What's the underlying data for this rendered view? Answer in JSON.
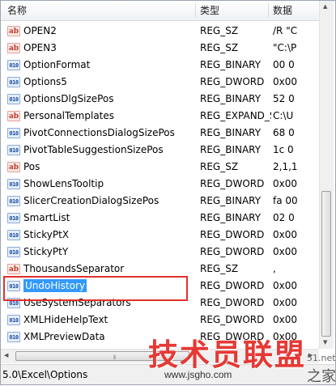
{
  "columns": {
    "name": "名称",
    "type": "类型",
    "data": "数据"
  },
  "rows": [
    {
      "icon": "ab",
      "kind": "sz",
      "name": "OPEN2",
      "type": "REG_SZ",
      "data": "/R \"C"
    },
    {
      "icon": "ab",
      "kind": "sz",
      "name": "OPEN3",
      "type": "REG_SZ",
      "data": "\"C:\\P"
    },
    {
      "icon": "010",
      "kind": "bin",
      "name": "OptionFormat",
      "type": "REG_BINARY",
      "data": "00 0"
    },
    {
      "icon": "010",
      "kind": "bin",
      "name": "Options5",
      "type": "REG_DWORD",
      "data": "0x00"
    },
    {
      "icon": "010",
      "kind": "bin",
      "name": "OptionsDlgSizePos",
      "type": "REG_BINARY",
      "data": "52 0"
    },
    {
      "icon": "ab",
      "kind": "sz",
      "name": "PersonalTemplates",
      "type": "REG_EXPAND_SZ",
      "data": "C:\\U"
    },
    {
      "icon": "010",
      "kind": "bin",
      "name": "PivotConnectionsDialogSizePos",
      "type": "REG_BINARY",
      "data": "68 0"
    },
    {
      "icon": "010",
      "kind": "bin",
      "name": "PivotTableSuggestionSizePos",
      "type": "REG_BINARY",
      "data": "1c 0"
    },
    {
      "icon": "ab",
      "kind": "sz",
      "name": "Pos",
      "type": "REG_SZ",
      "data": "2,1,1"
    },
    {
      "icon": "010",
      "kind": "bin",
      "name": "ShowLensTooltip",
      "type": "REG_DWORD",
      "data": "0x00"
    },
    {
      "icon": "010",
      "kind": "bin",
      "name": "SlicerCreationDialogSizePos",
      "type": "REG_BINARY",
      "data": "fa 00"
    },
    {
      "icon": "010",
      "kind": "bin",
      "name": "SmartList",
      "type": "REG_BINARY",
      "data": "02 0"
    },
    {
      "icon": "010",
      "kind": "bin",
      "name": "StickyPtX",
      "type": "REG_DWORD",
      "data": "0x00"
    },
    {
      "icon": "010",
      "kind": "bin",
      "name": "StickyPtY",
      "type": "REG_DWORD",
      "data": "0x00"
    },
    {
      "icon": "ab",
      "kind": "sz",
      "name": "ThousandsSeparator",
      "type": "REG_SZ",
      "data": ","
    },
    {
      "icon": "010",
      "kind": "bin",
      "name": "UndoHistory",
      "type": "REG_DWORD",
      "data": "0x00",
      "selected": true
    },
    {
      "icon": "010",
      "kind": "bin",
      "name": "UseSystemSeparators",
      "type": "REG_DWORD",
      "data": "0x00"
    },
    {
      "icon": "010",
      "kind": "bin",
      "name": "XMLHideHelpText",
      "type": "REG_DWORD",
      "data": "0x00"
    },
    {
      "icon": "010",
      "kind": "bin",
      "name": "XMLPreviewData",
      "type": "REG_DWORD",
      "data": "0x00"
    }
  ],
  "status": {
    "path": "5.0\\Excel\\Options"
  },
  "watermark": {
    "main": "技术员联盟",
    "url": "www.jsgho.com",
    "side": "之家",
    "num": "51.net"
  },
  "colors": {
    "selection": "#3399ff",
    "highlight_box": "#e0302a",
    "watermark": "#e53935"
  }
}
